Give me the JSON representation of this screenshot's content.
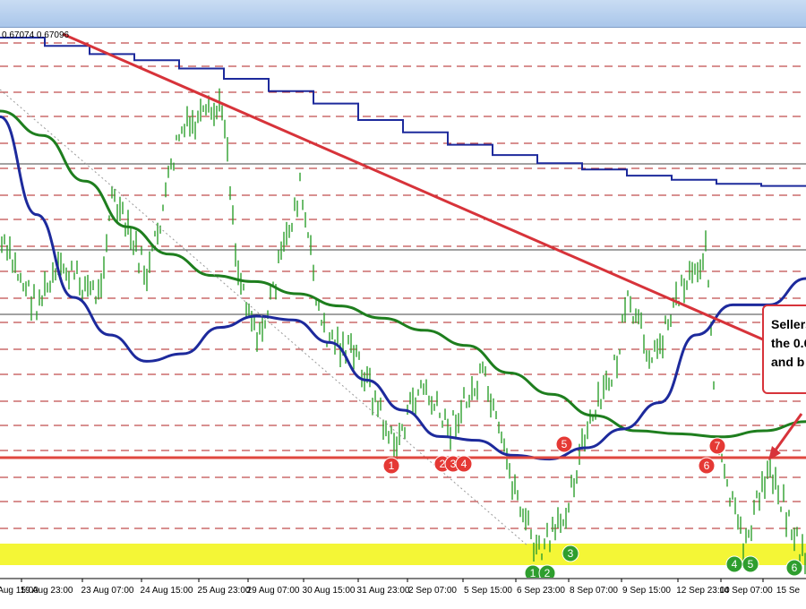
{
  "price_readout": "0.67074  0.67096",
  "annotation": {
    "lines": [
      "Sellers",
      "the 0.6",
      "and b"
    ]
  },
  "colors": {
    "downtrend": "#d7333a",
    "horizontal": "#e0473f",
    "ma_blue": "#1d2a9c",
    "ma_green": "#1e7e1e",
    "step_line": "#1d2a9c",
    "support_zone": "#f3f520",
    "candles": "#2d9f2d",
    "grid_dashed": "#b22222"
  },
  "chart_data": {
    "type": "line",
    "title": "",
    "xlabel": "",
    "ylabel": "",
    "x_ticks": [
      "Aug 15:00",
      "19 Aug 23:00",
      "23 Aug 07:00",
      "24 Aug 15:00",
      "25 Aug 23:00",
      "29 Aug 07:00",
      "30 Aug 15:00",
      "31 Aug 23:00",
      "2 Sep 07:00",
      "5 Sep 15:00",
      "6 Sep 23:00",
      "8 Sep 07:00",
      "9 Sep 15:00",
      "12 Sep 23:00",
      "14 Sep 07:00",
      "15 Se"
    ],
    "grid": true,
    "series": [
      {
        "kind": "step",
        "values": [
          0.0,
          0.04,
          0.08,
          0.11,
          0.15,
          0.2,
          0.26,
          0.32,
          0.4,
          0.46,
          0.52,
          0.57,
          0.61,
          0.64,
          0.67,
          0.69,
          0.71,
          0.72
        ]
      },
      {
        "kind": "ma_blue",
        "values": [
          0.12,
          0.38,
          0.6,
          0.7,
          0.77,
          0.75,
          0.68,
          0.65,
          0.66,
          0.72,
          0.82,
          0.9,
          0.97,
          0.98,
          1.02,
          1.03,
          1.0,
          0.95,
          0.88,
          0.7,
          0.62,
          0.62,
          0.55
        ]
      },
      {
        "kind": "ma_green",
        "values": [
          0.1,
          0.18,
          0.33,
          0.48,
          0.57,
          0.64,
          0.66,
          0.7,
          0.74,
          0.78,
          0.82,
          0.87,
          0.96,
          1.03,
          1.1,
          1.15,
          1.16,
          1.17,
          1.15,
          1.12
        ]
      },
      {
        "kind": "downtrend",
        "values": [
          0.0,
          1.0
        ]
      }
    ],
    "markers": [
      {
        "label": "1",
        "color": "red"
      },
      {
        "label": "2",
        "color": "red"
      },
      {
        "label": "3",
        "color": "red"
      },
      {
        "label": "4",
        "color": "red"
      },
      {
        "label": "5",
        "color": "red"
      },
      {
        "label": "6",
        "color": "red"
      },
      {
        "label": "7",
        "color": "red"
      },
      {
        "label": "1",
        "color": "green"
      },
      {
        "label": "2",
        "color": "green"
      },
      {
        "label": "3",
        "color": "green"
      },
      {
        "label": "4",
        "color": "green"
      },
      {
        "label": "5",
        "color": "green"
      },
      {
        "label": "6",
        "color": "green"
      }
    ]
  }
}
